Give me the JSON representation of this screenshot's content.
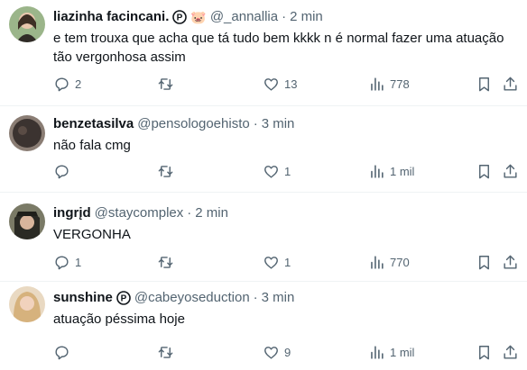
{
  "tweets": [
    {
      "name": "liazinha facincani.",
      "has_badge": true,
      "emoji": "🐷",
      "handle": "@_annallia",
      "separator": "·",
      "time": "2 min",
      "text": "e tem trouxa que acha que tá tudo bem kkkk n é normal fazer uma atuação tão vergonhosa assim",
      "replies": "2",
      "retweets": "",
      "likes": "13",
      "views": "778",
      "avatar_color": "#6b8f5e"
    },
    {
      "name": "benzetasilva",
      "has_badge": false,
      "emoji": "",
      "handle": "@pensologoehisto",
      "separator": "·",
      "time": "3 min",
      "text": "não fala cmg",
      "replies": "",
      "retweets": "",
      "likes": "1",
      "views": "1 mil",
      "avatar_color": "#3b3330"
    },
    {
      "name": "ingrįd",
      "has_badge": false,
      "emoji": "",
      "handle": "@staycomplex",
      "separator": "·",
      "time": "2 min",
      "text": "VERGONHA",
      "replies": "1",
      "retweets": "",
      "likes": "1",
      "views": "770",
      "avatar_color": "#4a4a3c"
    },
    {
      "name": "sunshine",
      "has_badge": true,
      "emoji": "",
      "handle": "@cabeyoseduction",
      "separator": "·",
      "time": "3 min",
      "text": "atuação péssima hoje",
      "replies": "",
      "retweets": "",
      "likes": "9",
      "views": "1 mil",
      "avatar_color": "#d9b98a"
    }
  ],
  "icons": {
    "reply": "reply-icon",
    "retweet": "retweet-icon",
    "like": "like-icon",
    "views": "views-icon",
    "bookmark": "bookmark-icon",
    "share": "share-icon",
    "badge": "verified-p-badge-icon"
  },
  "colors": {
    "text": "#0f1419",
    "secondary": "#536471",
    "divider": "#eff3f4"
  }
}
